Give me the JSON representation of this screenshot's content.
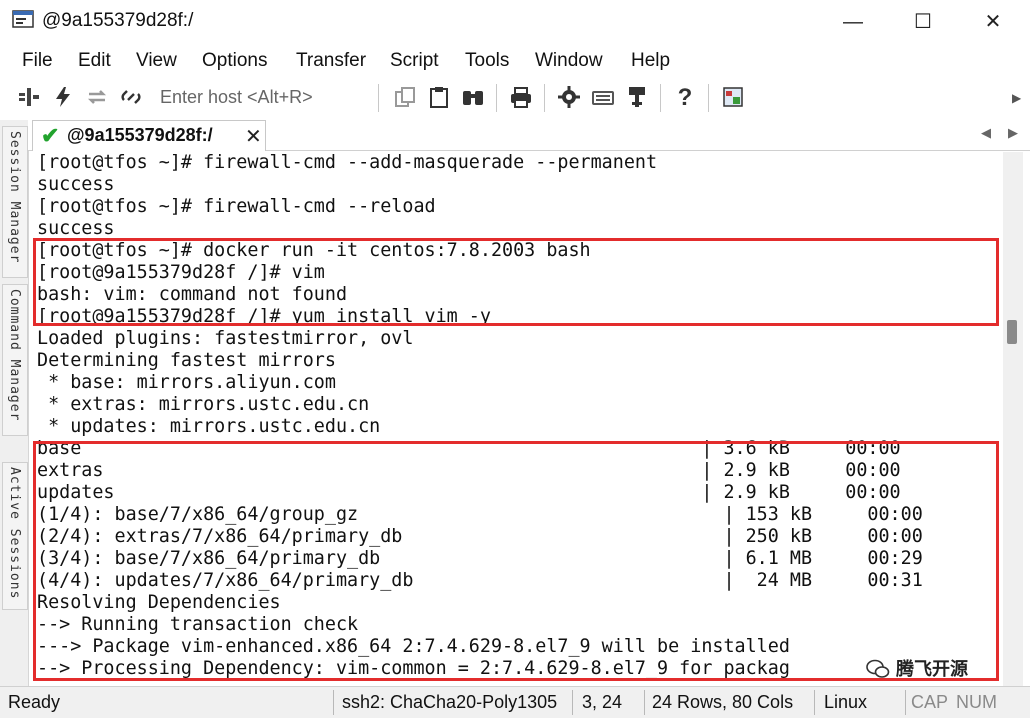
{
  "window": {
    "title": "@9a155379d28f:/",
    "minimize_glyph": "—",
    "maximize_glyph": "☐",
    "close_glyph": "✕"
  },
  "menu": [
    "File",
    "Edit",
    "View",
    "Options",
    "Transfer",
    "Script",
    "Tools",
    "Window",
    "Help"
  ],
  "toolbar": {
    "host_placeholder": "Enter host <Alt+R>",
    "icons": [
      "connect-icon",
      "lightning-icon",
      "reconnect-icon",
      "disconnect-icon",
      "copy-icon",
      "paste-icon",
      "find-icon",
      "print-icon",
      "settings-icon",
      "keymap-icon",
      "sftp-icon",
      "help-icon",
      "screen-icon"
    ]
  },
  "sidebar": {
    "tabs": [
      "Session Manager",
      "Command Manager",
      "Active Sessions"
    ]
  },
  "tab": {
    "label": "@9a155379d28f:/",
    "close": "✕"
  },
  "terminal": {
    "lines": [
      "[root@tfos ~]# firewall-cmd --add-masquerade --permanent",
      "success",
      "[root@tfos ~]# firewall-cmd --reload",
      "success",
      "[root@tfos ~]# docker run -it centos:7.8.2003 bash",
      "[root@9a155379d28f /]# vim",
      "bash: vim: command not found",
      "[root@9a155379d28f /]# yum install vim -y",
      "Loaded plugins: fastestmirror, ovl",
      "Determining fastest mirrors",
      " * base: mirrors.aliyun.com",
      " * extras: mirrors.ustc.edu.cn",
      " * updates: mirrors.ustc.edu.cn",
      "base                                                        | 3.6 kB     00:00",
      "extras                                                      | 2.9 kB     00:00",
      "updates                                                     | 2.9 kB     00:00",
      "(1/4): base/7/x86_64/group_gz                                 | 153 kB     00:00",
      "(2/4): extras/7/x86_64/primary_db                             | 250 kB     00:00",
      "(3/4): base/7/x86_64/primary_db                               | 6.1 MB     00:29",
      "(4/4): updates/7/x86_64/primary_db                            |  24 MB     00:31",
      "Resolving Dependencies",
      "--> Running transaction check",
      "---> Package vim-enhanced.x86_64 2:7.4.629-8.el7_9 will be installed",
      "--> Processing Dependency: vim-common = 2:7.4.629-8.el7_9 for packag"
    ],
    "highlight_color": "#e32c2c"
  },
  "status": {
    "ready": "Ready",
    "cipher": "ssh2: ChaCha20-Poly1305",
    "cursor": "3,  24",
    "size": "24 Rows, 80 Cols",
    "os": "Linux",
    "cap": "CAP",
    "num": "NUM"
  },
  "watermark": {
    "text": "腾飞开源"
  }
}
